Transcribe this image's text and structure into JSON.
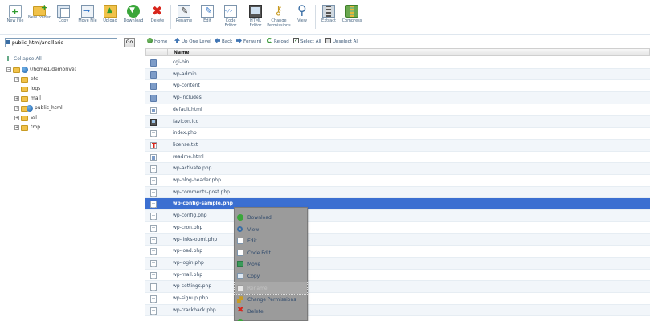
{
  "toolbar": {
    "items": [
      {
        "label": "New File",
        "icon": "new-file-icon"
      },
      {
        "label": "New Folder",
        "icon": "new-folder-icon"
      },
      {
        "label": "Copy",
        "icon": "copy-icon"
      },
      {
        "label": "Move File",
        "icon": "move-file-icon"
      },
      {
        "label": "Upload",
        "icon": "upload-icon"
      },
      {
        "label": "Download",
        "icon": "download-icon"
      },
      {
        "label": "Delete",
        "icon": "delete-icon"
      },
      {
        "label": "Rename",
        "icon": "rename-icon"
      },
      {
        "label": "Edit",
        "icon": "edit-icon"
      },
      {
        "label": "Code Editor",
        "icon": "code-editor-icon"
      },
      {
        "label": "HTML Editor",
        "icon": "html-editor-icon"
      },
      {
        "label": "Change Permissions",
        "icon": "key-icon"
      },
      {
        "label": "View",
        "icon": "magnifier-icon"
      },
      {
        "label": "Extract",
        "icon": "extract-icon"
      },
      {
        "label": "Compress",
        "icon": "compress-icon"
      }
    ]
  },
  "path": {
    "value": "public_html/ancillarie",
    "go_label": "Go"
  },
  "tree": {
    "collapse_label": "Collapse All",
    "root": "(/home1/demorive)",
    "nodes": [
      "etc",
      "logs",
      "mail",
      "public_html",
      "ssl",
      "tmp"
    ]
  },
  "nav": {
    "home": "Home",
    "up": "Up One Level",
    "back": "Back",
    "forward": "Forward",
    "reload": "Reload",
    "select_all": "Select All",
    "unselect_all": "Unselect All"
  },
  "table": {
    "name_header": "Name",
    "selected_index": 13,
    "files": [
      {
        "name": "cgi-bin",
        "icon": "folder-icon"
      },
      {
        "name": "wp-admin",
        "icon": "folder-icon"
      },
      {
        "name": "wp-content",
        "icon": "folder-icon"
      },
      {
        "name": "wp-includes",
        "icon": "folder-icon"
      },
      {
        "name": "default.html",
        "icon": "html-file-icon"
      },
      {
        "name": "favicon.ico",
        "icon": "image-file-icon"
      },
      {
        "name": "index.php",
        "icon": "php-file-icon"
      },
      {
        "name": "license.txt",
        "icon": "text-file-icon"
      },
      {
        "name": "readme.html",
        "icon": "html-file-icon"
      },
      {
        "name": "wp-activate.php",
        "icon": "php-file-icon"
      },
      {
        "name": "wp-blog-header.php",
        "icon": "php-file-icon"
      },
      {
        "name": "wp-comments-post.php",
        "icon": "php-file-icon"
      },
      {
        "name": "wp-config-sample.php",
        "icon": "php-file-icon"
      },
      {
        "name": "wp-config.php",
        "icon": "php-file-icon"
      },
      {
        "name": "wp-cron.php",
        "icon": "php-file-icon"
      },
      {
        "name": "wp-links-opml.php",
        "icon": "php-file-icon"
      },
      {
        "name": "wp-load.php",
        "icon": "php-file-icon"
      },
      {
        "name": "wp-login.php",
        "icon": "php-file-icon"
      },
      {
        "name": "wp-mail.php",
        "icon": "php-file-icon"
      },
      {
        "name": "wp-settings.php",
        "icon": "php-file-icon"
      },
      {
        "name": "wp-signup.php",
        "icon": "php-file-icon"
      },
      {
        "name": "wp-trackback.php",
        "icon": "php-file-icon"
      }
    ]
  },
  "context_menu": {
    "items": [
      {
        "label": "Download",
        "icon": "download-icon",
        "state": "enabled"
      },
      {
        "label": "View",
        "icon": "magnifier-icon",
        "state": "enabled"
      },
      {
        "label": "Edit",
        "icon": "edit-icon",
        "state": "enabled"
      },
      {
        "label": "Code Edit",
        "icon": "code-editor-icon",
        "state": "enabled"
      },
      {
        "label": "Move",
        "icon": "move-icon",
        "state": "enabled"
      },
      {
        "label": "Copy",
        "icon": "copy-icon",
        "state": "enabled"
      },
      {
        "label": "Rename",
        "icon": "rename-icon",
        "state": "hover"
      },
      {
        "label": "Change Permissions",
        "icon": "key-icon",
        "state": "enabled"
      },
      {
        "label": "Delete",
        "icon": "delete-icon",
        "state": "enabled"
      },
      {
        "label": "",
        "icon": "extract-icon",
        "state": "enabled"
      }
    ]
  },
  "colors": {
    "selection": "#3b6fd1",
    "link_text": "#3d5066",
    "menu_bg": "#9b9b9b"
  }
}
